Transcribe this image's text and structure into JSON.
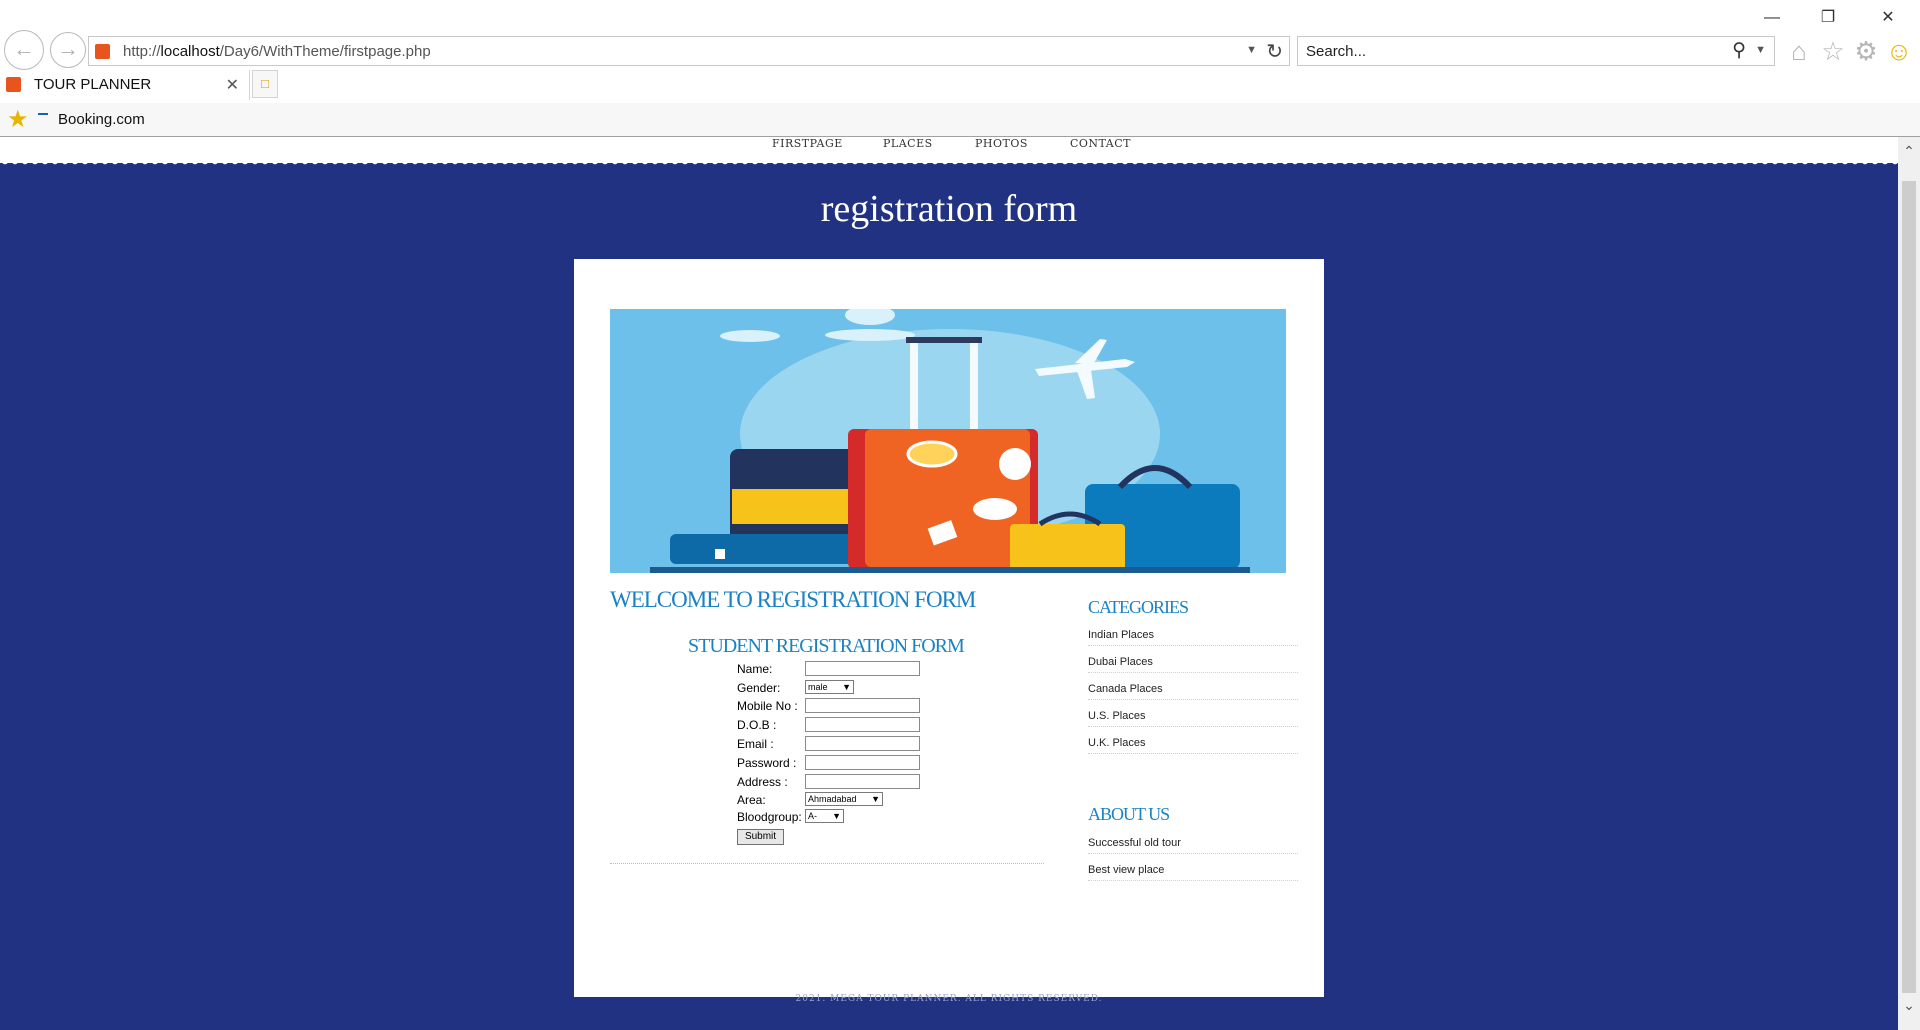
{
  "browser": {
    "url_prefix": "http://",
    "url_host": "localhost",
    "url_path": "/Day6/WithTheme/firstpage.php",
    "search_placeholder": "Search...",
    "tab_title": "TOUR PLANNER",
    "favorite": "Booking.com",
    "icons": [
      "back-icon",
      "forward-icon",
      "refresh-icon",
      "search-icon",
      "home-icon",
      "star-icon",
      "gear-icon",
      "smiley-icon"
    ]
  },
  "nav": {
    "items": [
      "FIRSTPAGE",
      "PLACES",
      "PHOTOS",
      "CONTACT"
    ]
  },
  "page": {
    "title": "registration form",
    "welcome": "WELCOME TO REGISTRATION FORM",
    "form_title": "STUDENT REGISTRATION FORM"
  },
  "form": {
    "name_label": "Name:",
    "gender_label": "Gender:",
    "gender_value": "male",
    "mobile_label": "Mobile No :",
    "dob_label": "D.O.B :",
    "email_label": "Email :",
    "password_label": "Password :",
    "address_label": "Address :",
    "area_label": "Area:",
    "area_value": "Ahmadabad",
    "blood_label": "Bloodgroup:",
    "blood_value": "A-",
    "submit_label": "Submit"
  },
  "sidebar": {
    "categories_title": "CATEGORIES",
    "categories": [
      "Indian Places",
      "Dubai Places",
      "Canada Places",
      "U.S. Places",
      "U.K. Places"
    ],
    "about_title": "ABOUT US",
    "about": [
      "Successful old tour",
      "Best view place"
    ]
  },
  "footer": "2021. MEGA TOUR PLANNER. ALL RIGHTS RESERVED.",
  "colors": {
    "background": "#223283",
    "heading_blue": "#1a82c4",
    "banner_sky": "#6cc0ea"
  }
}
